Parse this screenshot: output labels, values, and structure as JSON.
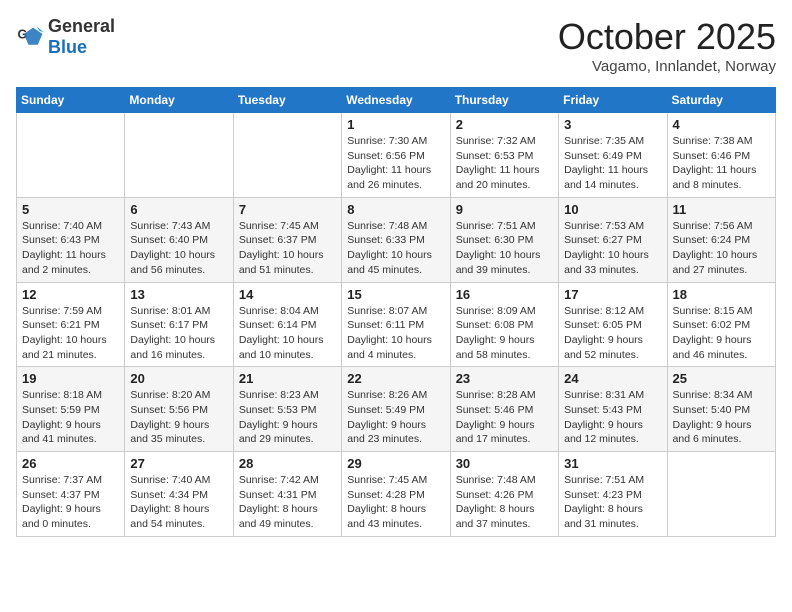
{
  "header": {
    "logo_general": "General",
    "logo_blue": "Blue",
    "month_title": "October 2025",
    "location": "Vagamo, Innlandet, Norway"
  },
  "weekdays": [
    "Sunday",
    "Monday",
    "Tuesday",
    "Wednesday",
    "Thursday",
    "Friday",
    "Saturday"
  ],
  "weeks": [
    [
      {
        "day": "",
        "info": ""
      },
      {
        "day": "",
        "info": ""
      },
      {
        "day": "",
        "info": ""
      },
      {
        "day": "1",
        "info": "Sunrise: 7:30 AM\nSunset: 6:56 PM\nDaylight: 11 hours\nand 26 minutes."
      },
      {
        "day": "2",
        "info": "Sunrise: 7:32 AM\nSunset: 6:53 PM\nDaylight: 11 hours\nand 20 minutes."
      },
      {
        "day": "3",
        "info": "Sunrise: 7:35 AM\nSunset: 6:49 PM\nDaylight: 11 hours\nand 14 minutes."
      },
      {
        "day": "4",
        "info": "Sunrise: 7:38 AM\nSunset: 6:46 PM\nDaylight: 11 hours\nand 8 minutes."
      }
    ],
    [
      {
        "day": "5",
        "info": "Sunrise: 7:40 AM\nSunset: 6:43 PM\nDaylight: 11 hours\nand 2 minutes."
      },
      {
        "day": "6",
        "info": "Sunrise: 7:43 AM\nSunset: 6:40 PM\nDaylight: 10 hours\nand 56 minutes."
      },
      {
        "day": "7",
        "info": "Sunrise: 7:45 AM\nSunset: 6:37 PM\nDaylight: 10 hours\nand 51 minutes."
      },
      {
        "day": "8",
        "info": "Sunrise: 7:48 AM\nSunset: 6:33 PM\nDaylight: 10 hours\nand 45 minutes."
      },
      {
        "day": "9",
        "info": "Sunrise: 7:51 AM\nSunset: 6:30 PM\nDaylight: 10 hours\nand 39 minutes."
      },
      {
        "day": "10",
        "info": "Sunrise: 7:53 AM\nSunset: 6:27 PM\nDaylight: 10 hours\nand 33 minutes."
      },
      {
        "day": "11",
        "info": "Sunrise: 7:56 AM\nSunset: 6:24 PM\nDaylight: 10 hours\nand 27 minutes."
      }
    ],
    [
      {
        "day": "12",
        "info": "Sunrise: 7:59 AM\nSunset: 6:21 PM\nDaylight: 10 hours\nand 21 minutes."
      },
      {
        "day": "13",
        "info": "Sunrise: 8:01 AM\nSunset: 6:17 PM\nDaylight: 10 hours\nand 16 minutes."
      },
      {
        "day": "14",
        "info": "Sunrise: 8:04 AM\nSunset: 6:14 PM\nDaylight: 10 hours\nand 10 minutes."
      },
      {
        "day": "15",
        "info": "Sunrise: 8:07 AM\nSunset: 6:11 PM\nDaylight: 10 hours\nand 4 minutes."
      },
      {
        "day": "16",
        "info": "Sunrise: 8:09 AM\nSunset: 6:08 PM\nDaylight: 9 hours\nand 58 minutes."
      },
      {
        "day": "17",
        "info": "Sunrise: 8:12 AM\nSunset: 6:05 PM\nDaylight: 9 hours\nand 52 minutes."
      },
      {
        "day": "18",
        "info": "Sunrise: 8:15 AM\nSunset: 6:02 PM\nDaylight: 9 hours\nand 46 minutes."
      }
    ],
    [
      {
        "day": "19",
        "info": "Sunrise: 8:18 AM\nSunset: 5:59 PM\nDaylight: 9 hours\nand 41 minutes."
      },
      {
        "day": "20",
        "info": "Sunrise: 8:20 AM\nSunset: 5:56 PM\nDaylight: 9 hours\nand 35 minutes."
      },
      {
        "day": "21",
        "info": "Sunrise: 8:23 AM\nSunset: 5:53 PM\nDaylight: 9 hours\nand 29 minutes."
      },
      {
        "day": "22",
        "info": "Sunrise: 8:26 AM\nSunset: 5:49 PM\nDaylight: 9 hours\nand 23 minutes."
      },
      {
        "day": "23",
        "info": "Sunrise: 8:28 AM\nSunset: 5:46 PM\nDaylight: 9 hours\nand 17 minutes."
      },
      {
        "day": "24",
        "info": "Sunrise: 8:31 AM\nSunset: 5:43 PM\nDaylight: 9 hours\nand 12 minutes."
      },
      {
        "day": "25",
        "info": "Sunrise: 8:34 AM\nSunset: 5:40 PM\nDaylight: 9 hours\nand 6 minutes."
      }
    ],
    [
      {
        "day": "26",
        "info": "Sunrise: 7:37 AM\nSunset: 4:37 PM\nDaylight: 9 hours\nand 0 minutes."
      },
      {
        "day": "27",
        "info": "Sunrise: 7:40 AM\nSunset: 4:34 PM\nDaylight: 8 hours\nand 54 minutes."
      },
      {
        "day": "28",
        "info": "Sunrise: 7:42 AM\nSunset: 4:31 PM\nDaylight: 8 hours\nand 49 minutes."
      },
      {
        "day": "29",
        "info": "Sunrise: 7:45 AM\nSunset: 4:28 PM\nDaylight: 8 hours\nand 43 minutes."
      },
      {
        "day": "30",
        "info": "Sunrise: 7:48 AM\nSunset: 4:26 PM\nDaylight: 8 hours\nand 37 minutes."
      },
      {
        "day": "31",
        "info": "Sunrise: 7:51 AM\nSunset: 4:23 PM\nDaylight: 8 hours\nand 31 minutes."
      },
      {
        "day": "",
        "info": ""
      }
    ]
  ]
}
